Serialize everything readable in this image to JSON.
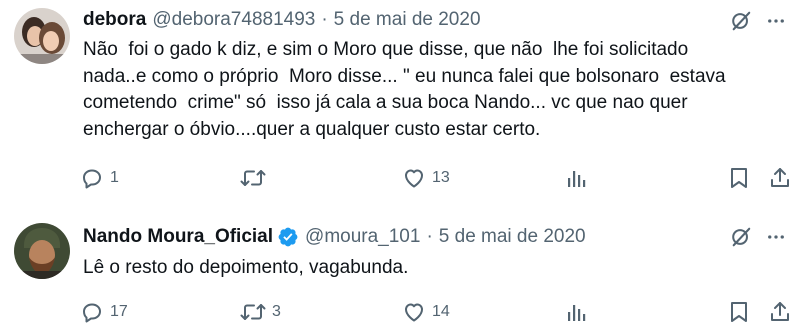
{
  "tweets": [
    {
      "display_name": "debora",
      "handle": "@debora74881493",
      "separator": "·",
      "date": "5 de mai de 2020",
      "verified": false,
      "text": "Não  foi o gado k diz, e sim o Moro que disse, que não  lhe foi solicitado\nnada..e como o próprio  Moro disse... \" eu nunca falei que bolsonaro  estava\ncometendo  crime\" só  isso já cala a sua boca Nando... vc que nao quer\nenchergar o óbvio....quer a qualquer custo estar certo.",
      "replies": "1",
      "retweets": "",
      "likes": "13",
      "icons": [
        "grok-icon",
        "more-icon",
        "reply-icon",
        "retweet-icon",
        "like-icon",
        "views-icon",
        "bookmark-icon",
        "share-icon"
      ]
    },
    {
      "display_name": "Nando Moura_Oficial",
      "handle": "@moura_101",
      "separator": "·",
      "date": "5 de mai de 2020",
      "verified": true,
      "text": "Lê o resto do depoimento, vagabunda.",
      "replies": "17",
      "retweets": "3",
      "likes": "14",
      "icons": [
        "verified-badge-icon",
        "grok-icon",
        "more-icon",
        "reply-icon",
        "retweet-icon",
        "like-icon",
        "views-icon",
        "bookmark-icon",
        "share-icon"
      ]
    }
  ],
  "colors": {
    "text": "#0f1419",
    "secondary": "#536471",
    "verified_blue": "#1d9bf0",
    "background": "#ffffff"
  }
}
